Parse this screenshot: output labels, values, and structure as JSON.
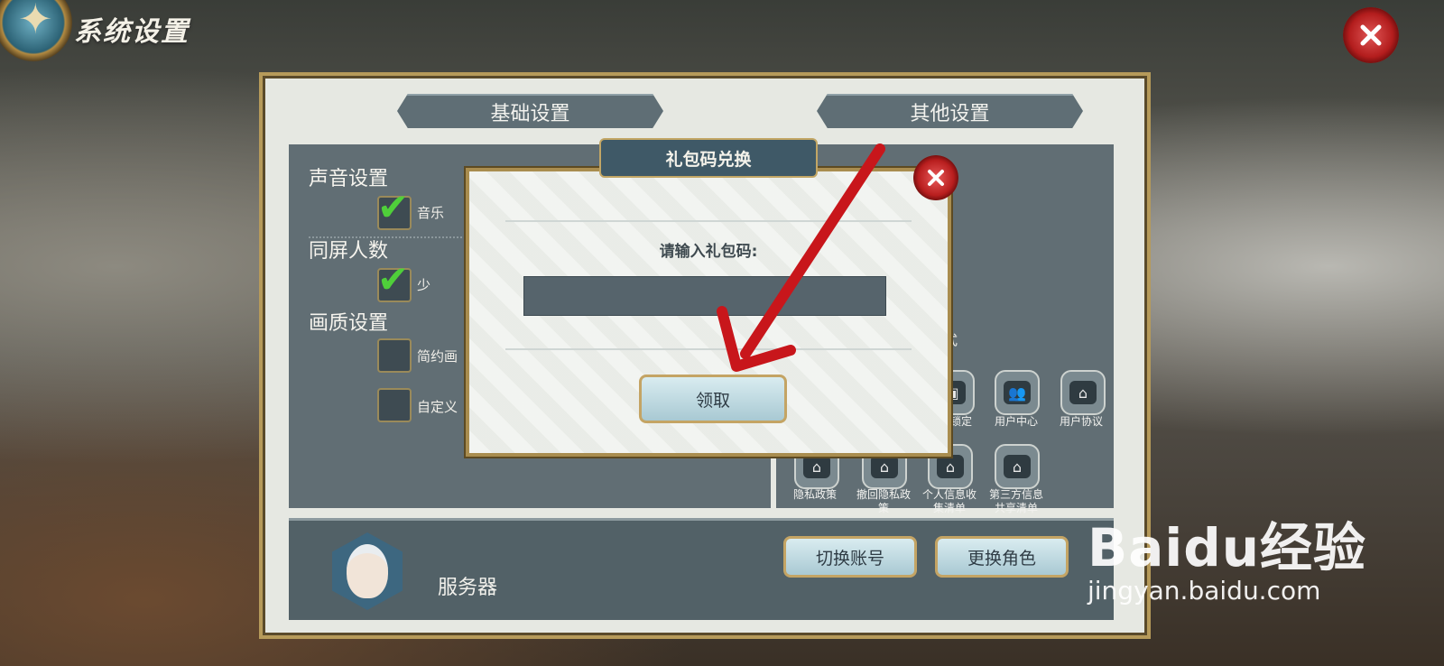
{
  "header": {
    "title": "系统设置"
  },
  "tabs": [
    {
      "label": "基础设置"
    },
    {
      "label": "其他设置"
    }
  ],
  "settings": {
    "sound": {
      "title": "声音设置",
      "options": [
        {
          "label": "音乐",
          "checked": true
        }
      ]
    },
    "players": {
      "title": "同屏人数",
      "options": [
        {
          "label": "少",
          "checked": true
        }
      ]
    },
    "quality": {
      "title": "画质设置",
      "options": [
        {
          "label": "简约画",
          "checked": false
        },
        {
          "label": "自定义",
          "checked": false
        }
      ]
    }
  },
  "right_panel": {
    "partial_text_1": "式",
    "icons": [
      {
        "label": "锁定",
        "icon": "lock-icon"
      },
      {
        "label": "用户中心",
        "icon": "users-icon"
      },
      {
        "label": "用户协议",
        "icon": "house-icon"
      },
      {
        "label": "隐私政策",
        "icon": "house-icon"
      },
      {
        "label": "撤回隐私政策",
        "icon": "house-icon"
      },
      {
        "label": "个人信息收集清单",
        "icon": "house-icon"
      },
      {
        "label": "第三方信息共享清单",
        "icon": "house-icon"
      }
    ]
  },
  "bottom": {
    "server_label": "服务器",
    "switch_account": "切换账号",
    "change_role": "更换角色"
  },
  "dialog": {
    "title": "礼包码兑换",
    "prompt": "请输入礼包码:",
    "input_value": "",
    "claim_button": "领取"
  },
  "watermark": {
    "logo": "Baidu经验",
    "url": "jingyan.baidu.com"
  },
  "colors": {
    "accent_gold": "#b69a5a",
    "panel_slate": "#616e74",
    "close_red": "#b31d1d",
    "arrow_red": "#c8161b"
  }
}
